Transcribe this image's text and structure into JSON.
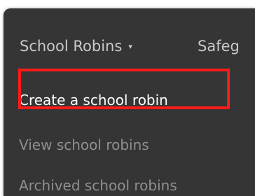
{
  "topnav": {
    "items": [
      {
        "label": "School Robins",
        "has_caret": true
      },
      {
        "label": "Safeg"
      }
    ],
    "caret_icon": "chevron-down-icon"
  },
  "dropdown": {
    "items": [
      {
        "label": "Create a school robin",
        "state": "highlighted"
      },
      {
        "label": "View school robins",
        "state": "muted"
      },
      {
        "label": "Archived school robins",
        "state": "muted"
      }
    ]
  },
  "colors": {
    "background": "#353535",
    "primary_text": "#ffffff",
    "muted_text": "#8f8f8f",
    "nav_text": "#c9c9c9",
    "highlight_border": "#ff1a1a"
  }
}
